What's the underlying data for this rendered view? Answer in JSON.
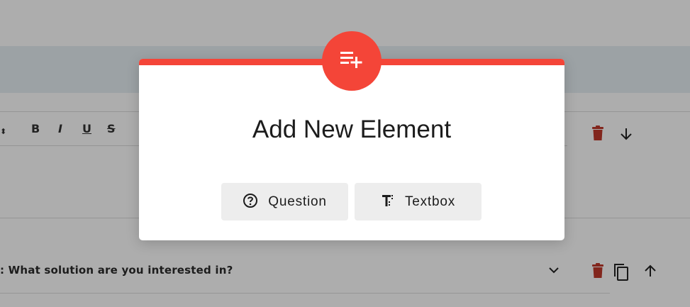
{
  "toolbar": {
    "bold": "B",
    "italic": "I",
    "underline": "U",
    "strike": "S",
    "updown": "⬍"
  },
  "question_row": {
    "text": ": What solution are you interested in?"
  },
  "modal": {
    "title": "Add New Element",
    "badge_icon": "playlist-add-icon",
    "buttons": [
      {
        "label": "Question",
        "icon": "help-circle-icon"
      },
      {
        "label": "Textbox",
        "icon": "text-format-icon"
      }
    ]
  },
  "colors": {
    "accent": "#f44538",
    "delete": "#c0392b",
    "button_bg": "#ededed",
    "band": "#e6eff3"
  }
}
